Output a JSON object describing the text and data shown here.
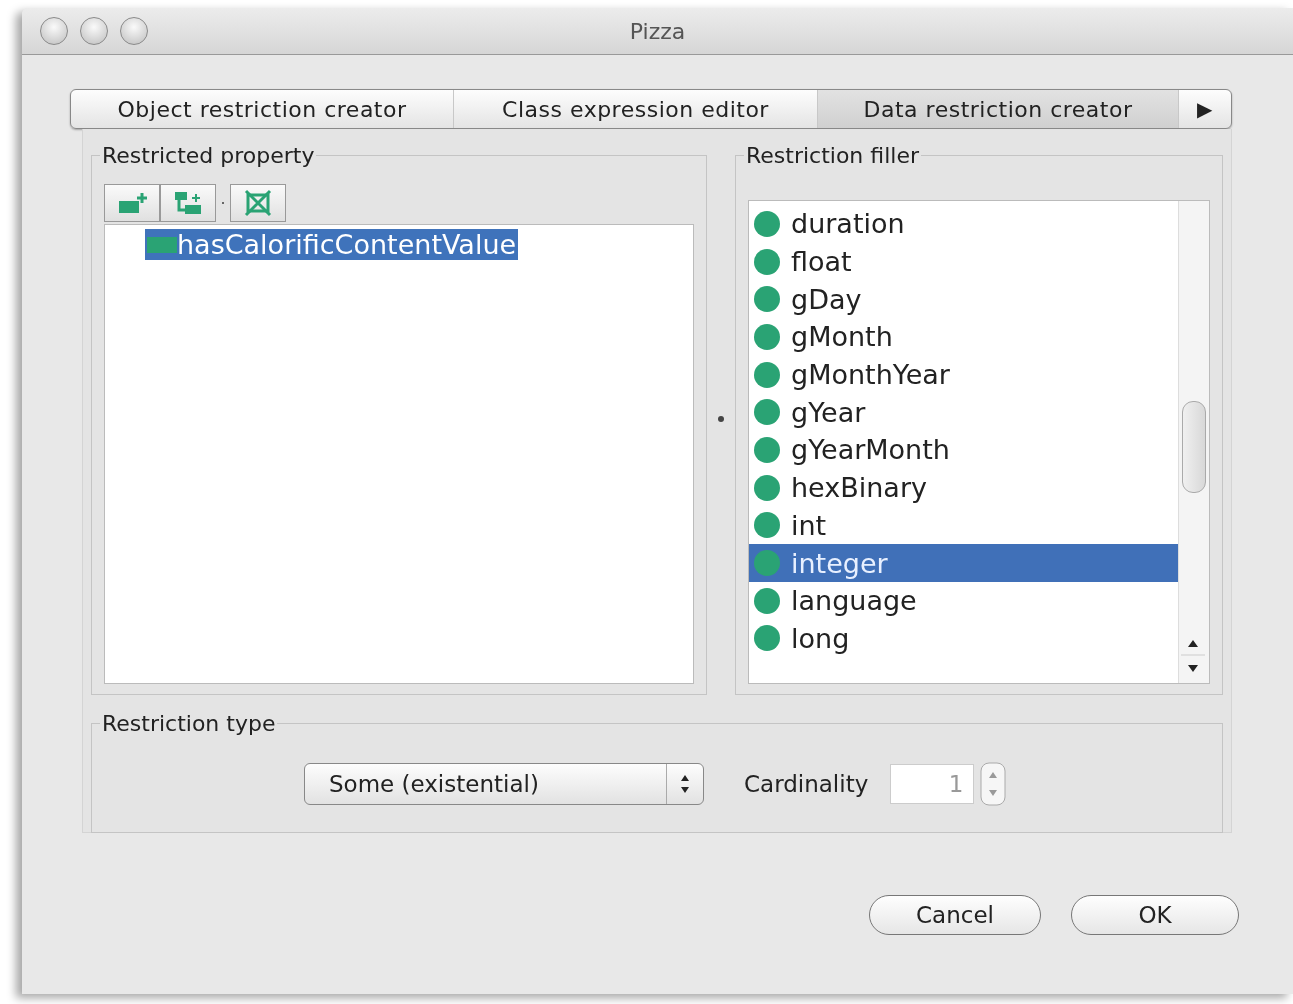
{
  "window": {
    "title": "Pizza"
  },
  "tabs": [
    {
      "label": "Object restriction creator",
      "selected": false
    },
    {
      "label": "Class expression editor",
      "selected": false
    },
    {
      "label": "Data restriction creator",
      "selected": true
    }
  ],
  "tab_scroll": "▶",
  "restricted_property": {
    "title": "Restricted property",
    "items": [
      {
        "label": "hasCalorificContentValue",
        "selected": true
      }
    ]
  },
  "restriction_filler": {
    "title": "Restriction filler",
    "items": [
      {
        "label": "duration",
        "selected": false
      },
      {
        "label": "float",
        "selected": false
      },
      {
        "label": "gDay",
        "selected": false
      },
      {
        "label": "gMonth",
        "selected": false
      },
      {
        "label": "gMonthYear",
        "selected": false
      },
      {
        "label": "gYear",
        "selected": false
      },
      {
        "label": "gYearMonth",
        "selected": false
      },
      {
        "label": "hexBinary",
        "selected": false
      },
      {
        "label": "int",
        "selected": false
      },
      {
        "label": "integer",
        "selected": true
      },
      {
        "label": "language",
        "selected": false
      },
      {
        "label": "long",
        "selected": false
      }
    ]
  },
  "restriction_type": {
    "title": "Restriction type",
    "value": "Some (existential)",
    "cardinality_label": "Cardinality",
    "cardinality": "1",
    "cardinality_disabled": true
  },
  "buttons": [
    "Cancel",
    "OK"
  ]
}
